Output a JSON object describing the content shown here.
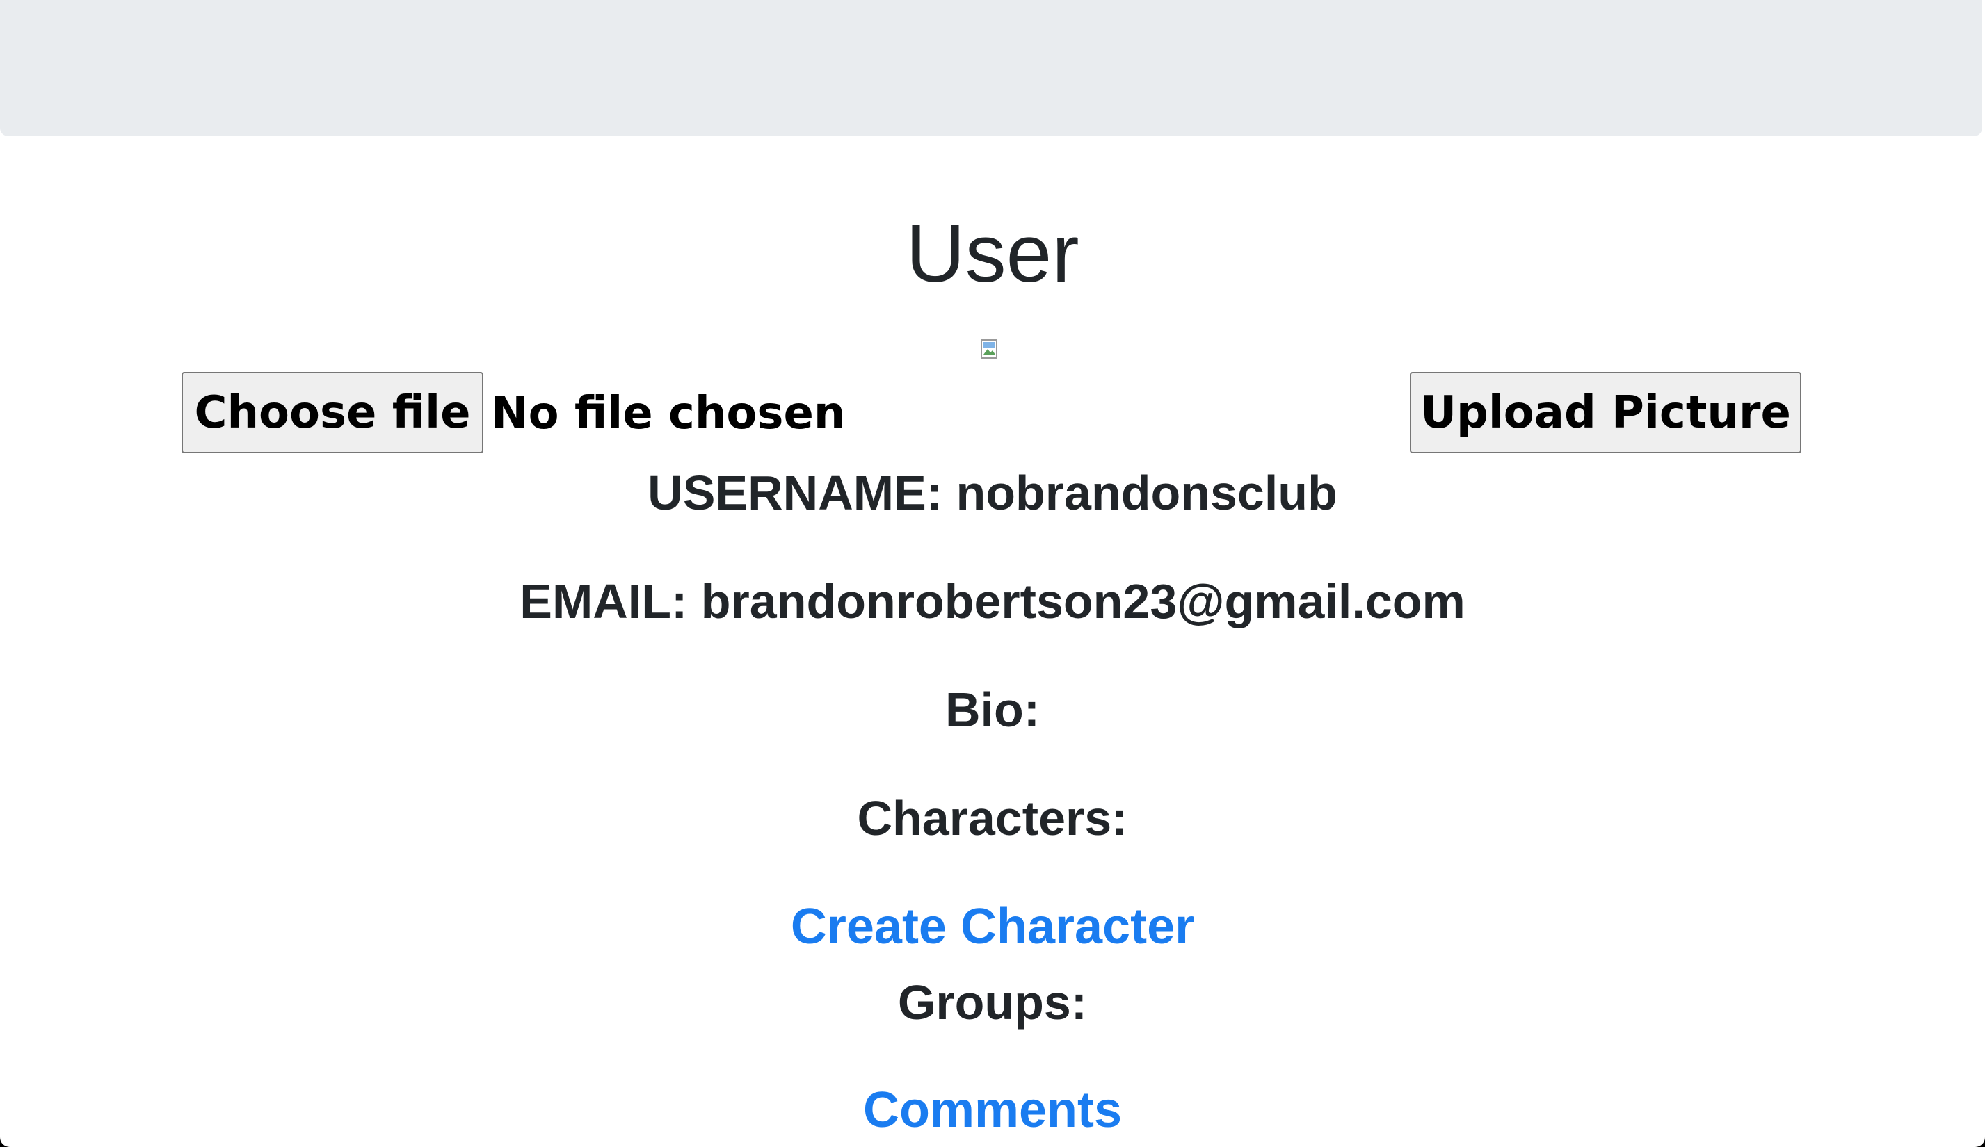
{
  "header": {
    "title": "User"
  },
  "upload": {
    "choose_label": "Choose file",
    "status": "No file chosen",
    "submit_label": "Upload Picture"
  },
  "profile": {
    "username": "USERNAME: nobrandonsclub",
    "email": "EMAIL: brandonrobertson23@gmail.com",
    "bio_label": "Bio:",
    "characters_label": "Characters:",
    "create_character_link": "Create Character",
    "groups_label": "Groups:",
    "comments_link": "Comments"
  },
  "colors": {
    "navbar": "#e9ecef",
    "text": "#212529",
    "link": "#1a7cf0"
  }
}
